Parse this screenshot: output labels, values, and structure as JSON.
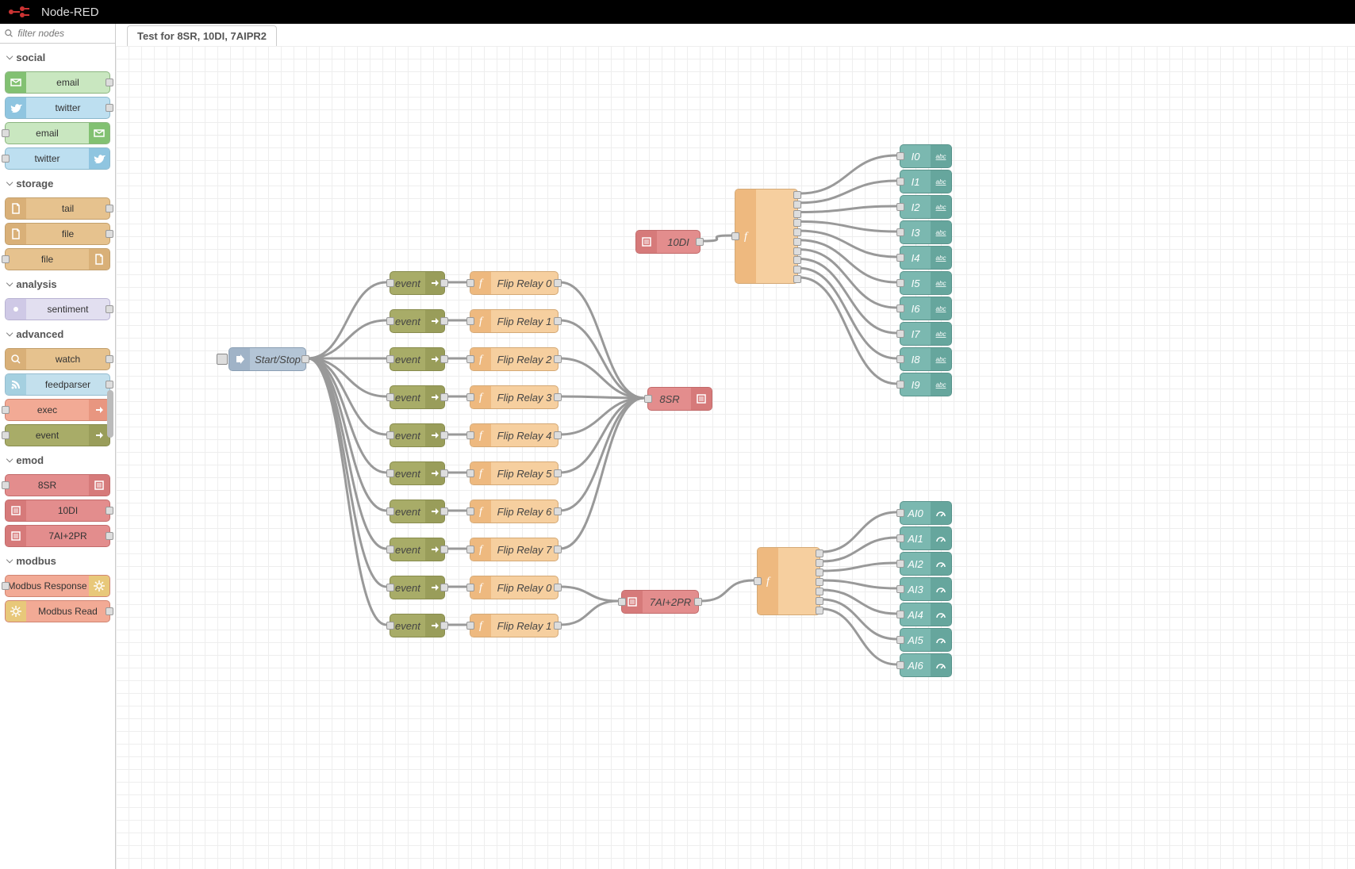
{
  "app_name": "Node-RED",
  "filter_placeholder": "filter nodes",
  "tab_title": "Test for 8SR, 10DI, 7AIPR2",
  "palette": {
    "social": {
      "label": "social",
      "nodes": [
        {
          "label": "email",
          "cls": "c-green",
          "icon": "mail",
          "side": "L"
        },
        {
          "label": "twitter",
          "cls": "c-blue",
          "icon": "bird",
          "side": "L"
        },
        {
          "label": "email",
          "cls": "c-green",
          "icon": "mail",
          "side": "R"
        },
        {
          "label": "twitter",
          "cls": "c-blue",
          "icon": "bird",
          "side": "R"
        }
      ]
    },
    "storage": {
      "label": "storage",
      "nodes": [
        {
          "label": "tail",
          "cls": "c-tan",
          "icon": "file",
          "side": "L"
        },
        {
          "label": "file",
          "cls": "c-tan",
          "icon": "file",
          "side": "L"
        },
        {
          "label": "file",
          "cls": "c-tan",
          "icon": "file",
          "side": "R"
        }
      ]
    },
    "analysis": {
      "label": "analysis",
      "nodes": [
        {
          "label": "sentiment",
          "cls": "c-lav",
          "icon": "dot",
          "side": "L"
        }
      ]
    },
    "advanced": {
      "label": "advanced",
      "nodes": [
        {
          "label": "watch",
          "cls": "c-tan",
          "icon": "search",
          "side": "L"
        },
        {
          "label": "feedparser",
          "cls": "c-lbl",
          "icon": "feed",
          "side": "L"
        },
        {
          "label": "exec",
          "cls": "c-sal",
          "icon": "arrow",
          "side": "R"
        },
        {
          "label": "event",
          "cls": "c-olv",
          "icon": "arrow",
          "side": "R"
        }
      ]
    },
    "emod": {
      "label": "emod",
      "nodes": [
        {
          "label": "8SR",
          "cls": "c-red",
          "icon": "mod",
          "side": "R"
        },
        {
          "label": "10DI",
          "cls": "c-red",
          "icon": "mod",
          "side": "L"
        },
        {
          "label": "7AI+2PR",
          "cls": "c-red",
          "icon": "mod",
          "side": "L"
        }
      ]
    },
    "modbus": {
      "label": "modbus",
      "nodes": [
        {
          "label": "Modbus Response",
          "cls": "c-mod",
          "icon": "gear",
          "side": "R"
        },
        {
          "label": "Modbus Read",
          "cls": "c-mod",
          "icon": "gear",
          "side": "L"
        }
      ]
    }
  },
  "flow": {
    "inject": {
      "label": "Start/Stop"
    },
    "events": [
      "event",
      "event",
      "event",
      "event",
      "event",
      "event",
      "event",
      "event",
      "event",
      "event"
    ],
    "flips": [
      "Flip Relay 0",
      "Flip Relay 1",
      "Flip Relay 2",
      "Flip Relay 3",
      "Flip Relay 4",
      "Flip Relay 5",
      "Flip Relay 6",
      "Flip Relay 7",
      "Flip Relay 0",
      "Flip Relay 1"
    ],
    "sr8": "8SR",
    "ai2pr": "7AI+2PR",
    "di10": "10DI",
    "digital": [
      "I0",
      "I1",
      "I2",
      "I3",
      "I4",
      "I5",
      "I6",
      "I7",
      "I8",
      "I9"
    ],
    "analog": [
      "AI0",
      "AI1",
      "AI2",
      "AI3",
      "AI4",
      "AI5",
      "AI6"
    ]
  }
}
